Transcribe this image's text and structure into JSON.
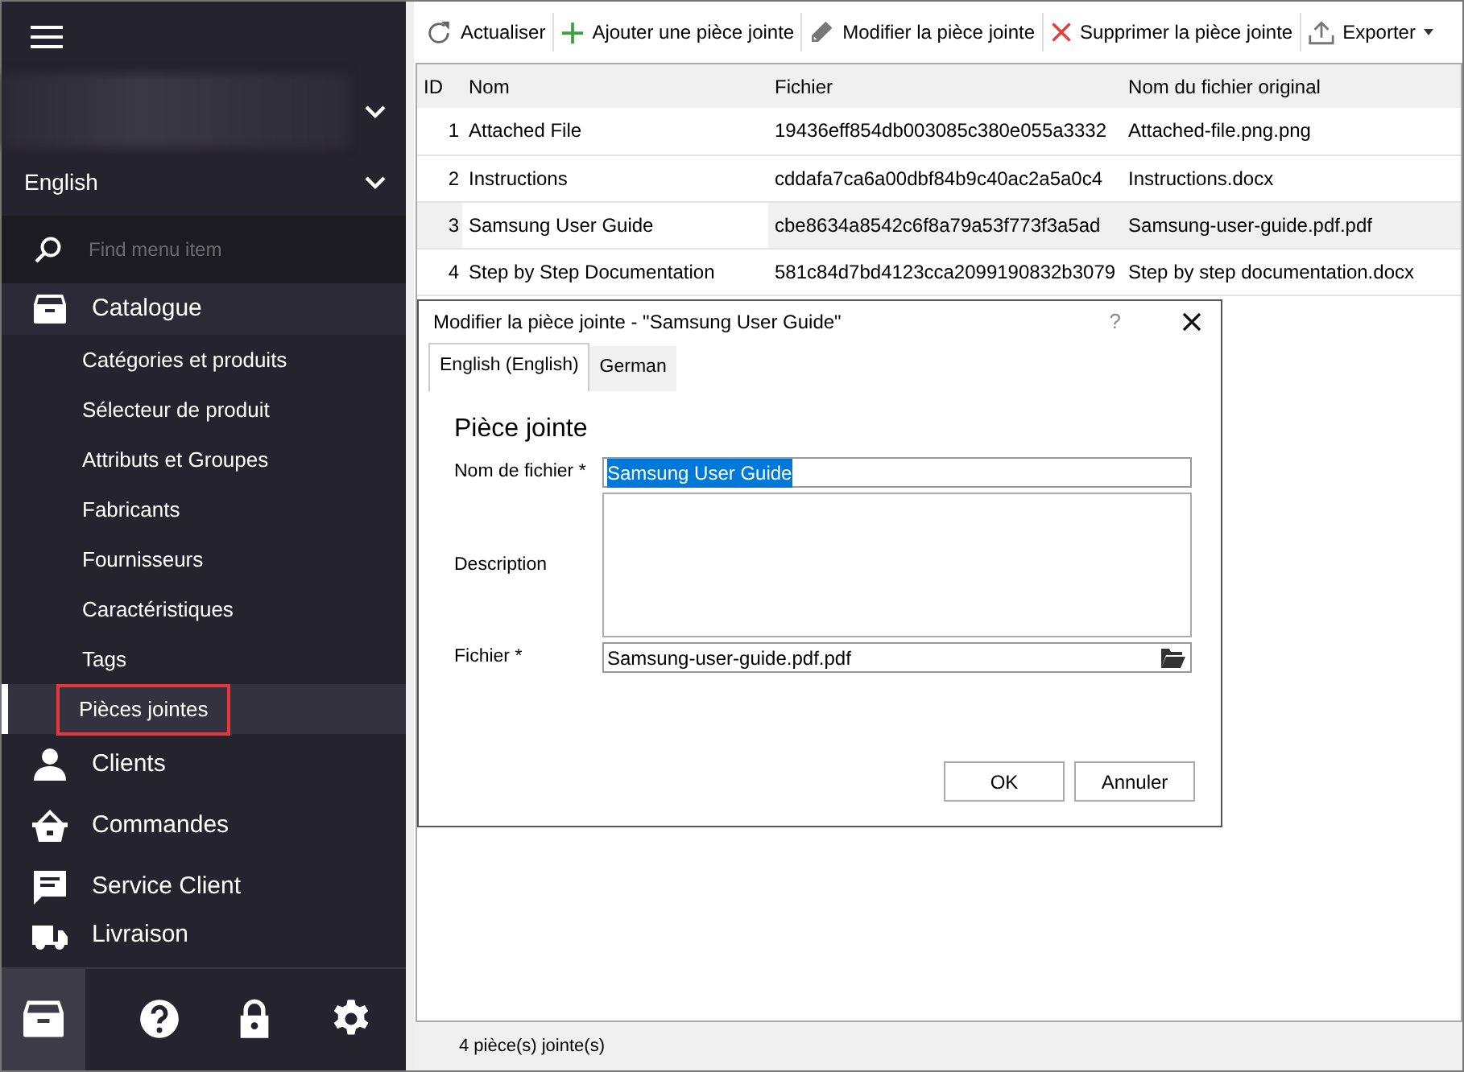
{
  "sidebar": {
    "language": "English",
    "search": {
      "placeholder": "Find menu item"
    },
    "items": [
      {
        "kind": "main",
        "label": "Catalogue",
        "selected": false
      },
      {
        "kind": "sub",
        "label": "Catégories et produits",
        "selected": false
      },
      {
        "kind": "sub",
        "label": "Sélecteur de produit",
        "selected": false
      },
      {
        "kind": "sub",
        "label": "Attributs et Groupes",
        "selected": false
      },
      {
        "kind": "sub",
        "label": "Fabricants",
        "selected": false
      },
      {
        "kind": "sub",
        "label": "Fournisseurs",
        "selected": false
      },
      {
        "kind": "sub",
        "label": "Caractéristiques",
        "selected": false
      },
      {
        "kind": "sub",
        "label": "Tags",
        "selected": false
      },
      {
        "kind": "sub",
        "label": "Pièces jointes",
        "selected": true
      },
      {
        "kind": "main",
        "label": "Clients",
        "selected": false
      },
      {
        "kind": "main",
        "label": "Commandes",
        "selected": false
      },
      {
        "kind": "main",
        "label": "Service Client",
        "selected": false
      },
      {
        "kind": "main",
        "label": "Livraison",
        "selected": false
      }
    ],
    "footer": [
      {
        "selected": true
      },
      {
        "selected": false
      },
      {
        "selected": false
      },
      {
        "selected": false
      }
    ]
  },
  "toolbar": [
    "Actualiser",
    "Ajouter une pièce jointe",
    "Modifier la pièce jointe",
    "Supprimer la pièce jointe",
    "Exporter"
  ],
  "table": {
    "columns": [
      "ID",
      "Nom",
      "Fichier",
      "Nom du fichier original"
    ],
    "rows": [
      {
        "cells": [
          "1",
          "Attached File",
          "19436eff854db003085c380e055a3332",
          "Attached-file.png.png"
        ],
        "selected": false
      },
      {
        "cells": [
          "2",
          "Instructions",
          "cddafa7ca6a00dbf84b9c40ac2a5a0c4",
          "Instructions.docx"
        ],
        "selected": false
      },
      {
        "cells": [
          "3",
          "Samsung User Guide",
          "cbe8634a8542c6f8a79a53f773f3a5ad",
          "Samsung-user-guide.pdf.pdf"
        ],
        "selected": true
      },
      {
        "cells": [
          "4",
          "Step by Step Documentation",
          "581c84d7bd4123cca2099190832b3079",
          "Step by step documentation.docx"
        ],
        "selected": false
      }
    ]
  },
  "status_bar": "4 pièce(s) jointe(s)",
  "dialog": {
    "title": "Modifier la pièce jointe - \"Samsung User Guide\"",
    "help": "?",
    "tabs": [
      {
        "label": "English (English)",
        "selected": true
      },
      {
        "label": "German",
        "selected": false
      }
    ],
    "heading": "Pièce jointe",
    "fields": [
      {
        "kind": "text",
        "label": "Nom de fichier *",
        "value": "Samsung User Guide"
      },
      {
        "kind": "textarea",
        "label": "Description"
      },
      {
        "kind": "file",
        "label": "Fichier *",
        "value": "Samsung-user-guide.pdf.pdf"
      }
    ],
    "buttons": [
      "OK",
      "Annuler"
    ]
  }
}
